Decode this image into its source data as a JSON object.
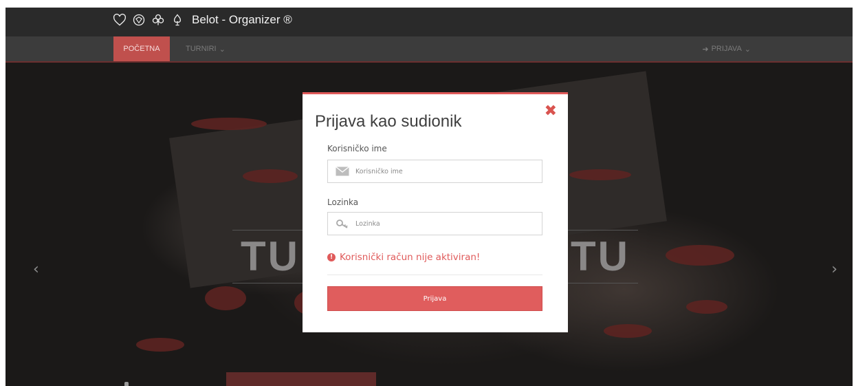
{
  "brand": {
    "title": "Belot - Organizer ®",
    "suits": [
      "heart-icon",
      "diamond-icon",
      "club-icon",
      "spade-icon"
    ]
  },
  "nav": {
    "home": "POČETNA",
    "tournaments": "TURNIRI",
    "login": "PRIJAVA"
  },
  "hero": {
    "text_left": "TU",
    "text_right": "OTU"
  },
  "modal": {
    "title": "Prijava kao sudionik",
    "username_label": "Korisničko ime",
    "username_placeholder": "Korisničko ime",
    "password_label": "Lozinka",
    "password_placeholder": "Lozinka",
    "error_text": "Korisnički račun nije aktiviran!",
    "submit_label": "Prijava"
  },
  "colors": {
    "accent": "#e05a5a",
    "nav_active": "#c0504d",
    "topbar": "#2a2a2a",
    "navbar": "#3c3c3c"
  }
}
